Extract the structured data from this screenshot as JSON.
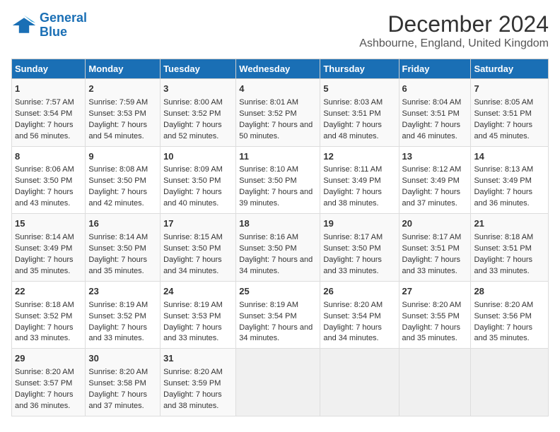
{
  "logo": {
    "line1": "General",
    "line2": "Blue"
  },
  "title": "December 2024",
  "subtitle": "Ashbourne, England, United Kingdom",
  "days_of_week": [
    "Sunday",
    "Monday",
    "Tuesday",
    "Wednesday",
    "Thursday",
    "Friday",
    "Saturday"
  ],
  "weeks": [
    [
      {
        "day": 1,
        "sunrise": "Sunrise: 7:57 AM",
        "sunset": "Sunset: 3:54 PM",
        "daylight": "Daylight: 7 hours and 56 minutes."
      },
      {
        "day": 2,
        "sunrise": "Sunrise: 7:59 AM",
        "sunset": "Sunset: 3:53 PM",
        "daylight": "Daylight: 7 hours and 54 minutes."
      },
      {
        "day": 3,
        "sunrise": "Sunrise: 8:00 AM",
        "sunset": "Sunset: 3:52 PM",
        "daylight": "Daylight: 7 hours and 52 minutes."
      },
      {
        "day": 4,
        "sunrise": "Sunrise: 8:01 AM",
        "sunset": "Sunset: 3:52 PM",
        "daylight": "Daylight: 7 hours and 50 minutes."
      },
      {
        "day": 5,
        "sunrise": "Sunrise: 8:03 AM",
        "sunset": "Sunset: 3:51 PM",
        "daylight": "Daylight: 7 hours and 48 minutes."
      },
      {
        "day": 6,
        "sunrise": "Sunrise: 8:04 AM",
        "sunset": "Sunset: 3:51 PM",
        "daylight": "Daylight: 7 hours and 46 minutes."
      },
      {
        "day": 7,
        "sunrise": "Sunrise: 8:05 AM",
        "sunset": "Sunset: 3:51 PM",
        "daylight": "Daylight: 7 hours and 45 minutes."
      }
    ],
    [
      {
        "day": 8,
        "sunrise": "Sunrise: 8:06 AM",
        "sunset": "Sunset: 3:50 PM",
        "daylight": "Daylight: 7 hours and 43 minutes."
      },
      {
        "day": 9,
        "sunrise": "Sunrise: 8:08 AM",
        "sunset": "Sunset: 3:50 PM",
        "daylight": "Daylight: 7 hours and 42 minutes."
      },
      {
        "day": 10,
        "sunrise": "Sunrise: 8:09 AM",
        "sunset": "Sunset: 3:50 PM",
        "daylight": "Daylight: 7 hours and 40 minutes."
      },
      {
        "day": 11,
        "sunrise": "Sunrise: 8:10 AM",
        "sunset": "Sunset: 3:50 PM",
        "daylight": "Daylight: 7 hours and 39 minutes."
      },
      {
        "day": 12,
        "sunrise": "Sunrise: 8:11 AM",
        "sunset": "Sunset: 3:49 PM",
        "daylight": "Daylight: 7 hours and 38 minutes."
      },
      {
        "day": 13,
        "sunrise": "Sunrise: 8:12 AM",
        "sunset": "Sunset: 3:49 PM",
        "daylight": "Daylight: 7 hours and 37 minutes."
      },
      {
        "day": 14,
        "sunrise": "Sunrise: 8:13 AM",
        "sunset": "Sunset: 3:49 PM",
        "daylight": "Daylight: 7 hours and 36 minutes."
      }
    ],
    [
      {
        "day": 15,
        "sunrise": "Sunrise: 8:14 AM",
        "sunset": "Sunset: 3:49 PM",
        "daylight": "Daylight: 7 hours and 35 minutes."
      },
      {
        "day": 16,
        "sunrise": "Sunrise: 8:14 AM",
        "sunset": "Sunset: 3:50 PM",
        "daylight": "Daylight: 7 hours and 35 minutes."
      },
      {
        "day": 17,
        "sunrise": "Sunrise: 8:15 AM",
        "sunset": "Sunset: 3:50 PM",
        "daylight": "Daylight: 7 hours and 34 minutes."
      },
      {
        "day": 18,
        "sunrise": "Sunrise: 8:16 AM",
        "sunset": "Sunset: 3:50 PM",
        "daylight": "Daylight: 7 hours and 34 minutes."
      },
      {
        "day": 19,
        "sunrise": "Sunrise: 8:17 AM",
        "sunset": "Sunset: 3:50 PM",
        "daylight": "Daylight: 7 hours and 33 minutes."
      },
      {
        "day": 20,
        "sunrise": "Sunrise: 8:17 AM",
        "sunset": "Sunset: 3:51 PM",
        "daylight": "Daylight: 7 hours and 33 minutes."
      },
      {
        "day": 21,
        "sunrise": "Sunrise: 8:18 AM",
        "sunset": "Sunset: 3:51 PM",
        "daylight": "Daylight: 7 hours and 33 minutes."
      }
    ],
    [
      {
        "day": 22,
        "sunrise": "Sunrise: 8:18 AM",
        "sunset": "Sunset: 3:52 PM",
        "daylight": "Daylight: 7 hours and 33 minutes."
      },
      {
        "day": 23,
        "sunrise": "Sunrise: 8:19 AM",
        "sunset": "Sunset: 3:52 PM",
        "daylight": "Daylight: 7 hours and 33 minutes."
      },
      {
        "day": 24,
        "sunrise": "Sunrise: 8:19 AM",
        "sunset": "Sunset: 3:53 PM",
        "daylight": "Daylight: 7 hours and 33 minutes."
      },
      {
        "day": 25,
        "sunrise": "Sunrise: 8:19 AM",
        "sunset": "Sunset: 3:54 PM",
        "daylight": "Daylight: 7 hours and 34 minutes."
      },
      {
        "day": 26,
        "sunrise": "Sunrise: 8:20 AM",
        "sunset": "Sunset: 3:54 PM",
        "daylight": "Daylight: 7 hours and 34 minutes."
      },
      {
        "day": 27,
        "sunrise": "Sunrise: 8:20 AM",
        "sunset": "Sunset: 3:55 PM",
        "daylight": "Daylight: 7 hours and 35 minutes."
      },
      {
        "day": 28,
        "sunrise": "Sunrise: 8:20 AM",
        "sunset": "Sunset: 3:56 PM",
        "daylight": "Daylight: 7 hours and 35 minutes."
      }
    ],
    [
      {
        "day": 29,
        "sunrise": "Sunrise: 8:20 AM",
        "sunset": "Sunset: 3:57 PM",
        "daylight": "Daylight: 7 hours and 36 minutes."
      },
      {
        "day": 30,
        "sunrise": "Sunrise: 8:20 AM",
        "sunset": "Sunset: 3:58 PM",
        "daylight": "Daylight: 7 hours and 37 minutes."
      },
      {
        "day": 31,
        "sunrise": "Sunrise: 8:20 AM",
        "sunset": "Sunset: 3:59 PM",
        "daylight": "Daylight: 7 hours and 38 minutes."
      },
      null,
      null,
      null,
      null
    ]
  ]
}
